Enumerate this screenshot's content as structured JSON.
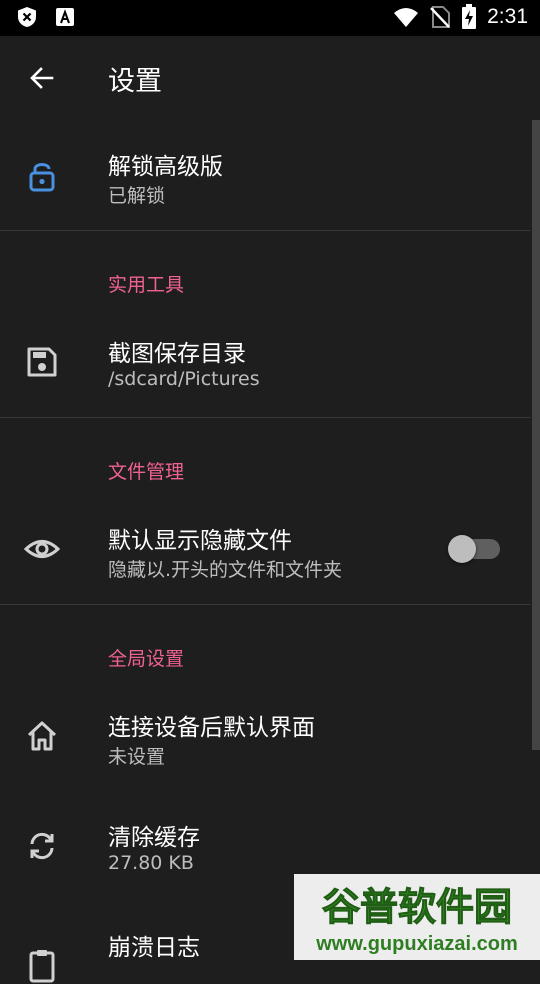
{
  "status": {
    "time": "2:31"
  },
  "toolbar": {
    "title": "设置"
  },
  "items": {
    "unlock": {
      "title": "解锁高级版",
      "subtitle": "已解锁"
    },
    "screenshot_dir": {
      "title": "截图保存目录",
      "subtitle": "/sdcard/Pictures"
    },
    "hidden_files": {
      "title": "默认显示隐藏文件",
      "subtitle": "隐藏以.开头的文件和文件夹",
      "enabled": false
    },
    "default_screen": {
      "title": "连接设备后默认界面",
      "subtitle": "未设置"
    },
    "clear_cache": {
      "title": "清除缓存",
      "subtitle": "27.80 KB"
    },
    "crash_log": {
      "title": "崩溃日志"
    }
  },
  "sections": {
    "tools": "实用工具",
    "file_mgmt": "文件管理",
    "global": "全局设置"
  },
  "watermark": {
    "text": "谷普软件园",
    "url": "www.gupuxiazai.com"
  },
  "colors": {
    "accent_section": "#f06292",
    "lock_icon": "#4a90e2",
    "background": "#1e1e1e",
    "status_bar": "#000000"
  },
  "icons": [
    "close-shield-icon",
    "a-icon",
    "wifi-icon",
    "no-sim-icon",
    "battery-charging-icon",
    "back-arrow-icon",
    "lock-icon",
    "save-icon",
    "eye-icon",
    "home-icon",
    "sync-icon",
    "clipboard-icon"
  ]
}
